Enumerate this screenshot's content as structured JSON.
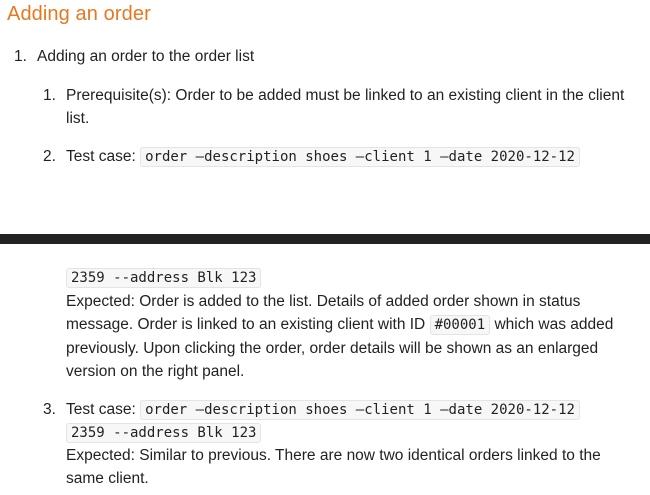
{
  "heading": "Adding an order",
  "item1": {
    "num": "1.",
    "title": "Adding an order to the order list"
  },
  "sub1": {
    "num": "1.",
    "line1": "Prerequisite(s): Order to be added must be linked to an existing client in the client",
    "line2": "list."
  },
  "sub2": {
    "num": "2.",
    "label": "Test case:",
    "code_part1": "order —description shoes —client 1 —date 2020-12-12",
    "code_part2": "2359 --address Blk 123",
    "expected_line1": "Expected: Order is added to the list. Details of added order shown in status",
    "expected_line2_pre": "message. Order is linked to an existing client with ID",
    "expected_line2_code": "#00001",
    "expected_line2_post": "which was added",
    "expected_line3": "previously. Upon clicking the order, order details will be shown as an enlarged",
    "expected_line4": "version on the right panel."
  },
  "sub3": {
    "num": "3.",
    "label": "Test case:",
    "code_part1": "order —description shoes —client 1 —date 2020-12-12",
    "code_part2": "2359 --address Blk 123",
    "expected_line1": "Expected: Similar to previous. There are now two identical orders linked to the",
    "expected_line2": "same client."
  }
}
